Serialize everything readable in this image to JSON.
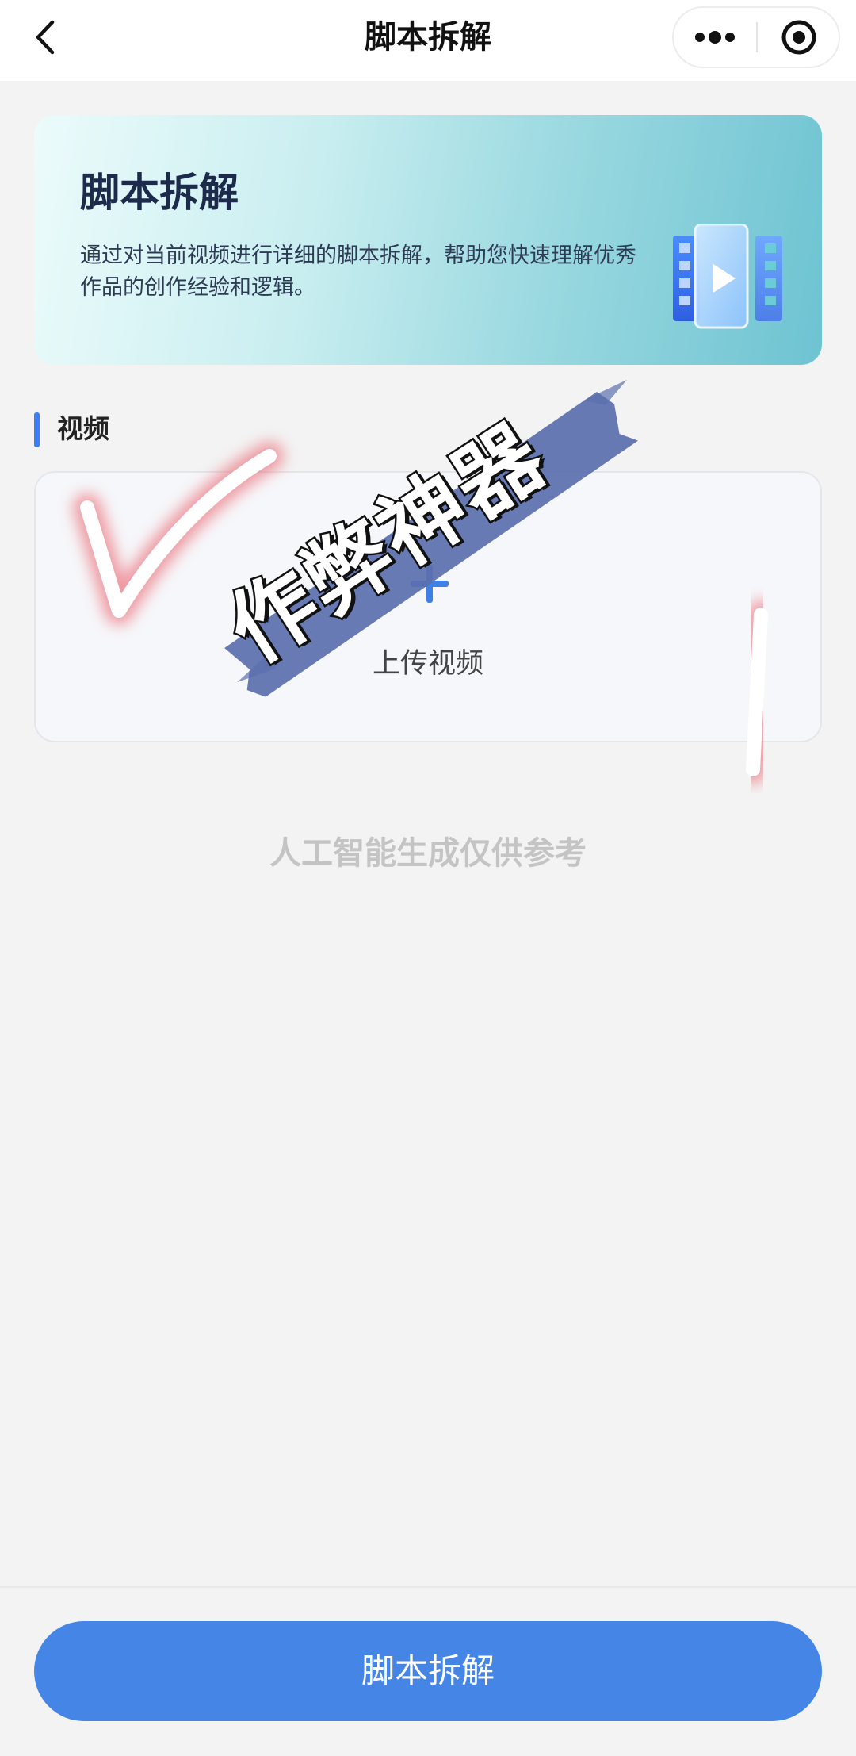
{
  "header": {
    "title": "脚本拆解"
  },
  "icons": {
    "back": "back-icon",
    "more": "more-dots-icon",
    "record": "record-target-icon",
    "video": "video-film-icon",
    "plus": "plus-icon"
  },
  "banner": {
    "title": "脚本拆解",
    "description": "通过对当前视频进行详细的脚本拆解，帮助您快速理解优秀作品的创作经验和逻辑。"
  },
  "section": {
    "label": "视频"
  },
  "upload": {
    "label": "上传视频"
  },
  "disclaimer": "人工智能生成仅供参考",
  "overlay": {
    "sticker_text": "作弊神器"
  },
  "action": {
    "submit_label": "脚本拆解"
  },
  "colors": {
    "accent": "#4585e6",
    "section_bar": "#3d7ff0",
    "banner_title": "#1c2a4b",
    "sticker_brush": "#5b6fae",
    "glow": "#e8505b"
  }
}
